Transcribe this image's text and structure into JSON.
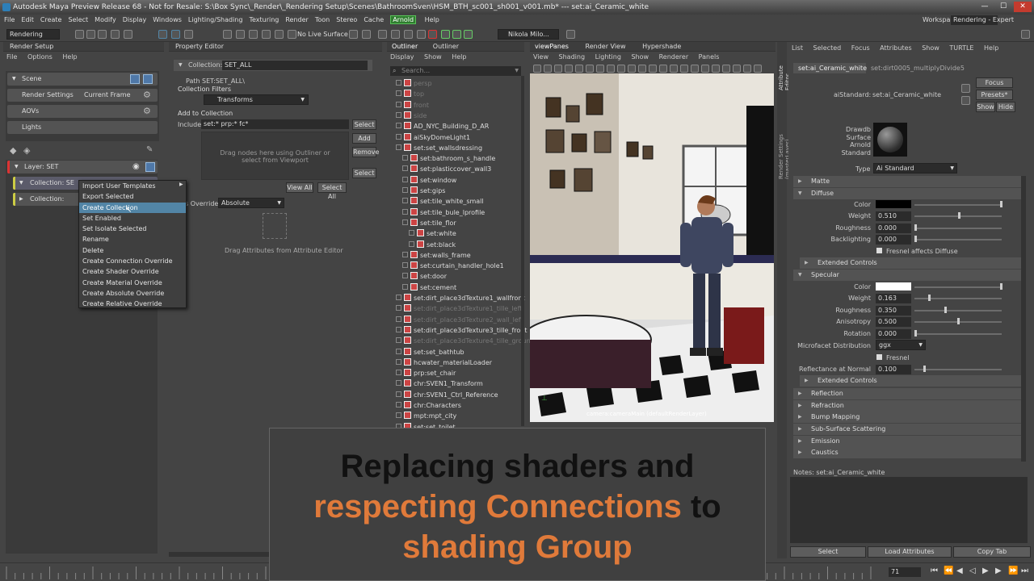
{
  "window": {
    "title": "Autodesk Maya Preview Release 68 - Not for Resale: S:\\Box Sync\\_Render\\_Rendering Setup\\Scenes\\BathroomSven\\HSM_BTH_sc001_sh001_v001.mb*  ---  set:ai_Ceramic_white"
  },
  "menubar": {
    "items": [
      "File",
      "Edit",
      "Create",
      "Select",
      "Modify",
      "Display",
      "Windows",
      "Lighting/Shading",
      "Texturing",
      "Render",
      "Toon",
      "Stereo",
      "Cache"
    ],
    "arnold": "Arnold",
    "help": "Help",
    "workspace_label": "Workspace :",
    "workspace_value": "Rendering - Expert"
  },
  "statusbar": {
    "mode": "Rendering",
    "live_surface": "No Live Surface",
    "user": "Nikola Milo..."
  },
  "render_setup": {
    "title": "Render Setup",
    "menu": [
      "File",
      "Options",
      "Help"
    ],
    "scene": "Scene",
    "render_settings": "Render Settings",
    "current_frame": "Current Frame",
    "aovs": "AOVs",
    "lights": "Lights",
    "layer": "Layer:  SET",
    "collection1": "Collection:  SE",
    "collection2": "Collection:"
  },
  "context_menu": {
    "items": [
      "Import User Templates",
      "Export Selected",
      "Create Collection",
      "Set Enabled",
      "Set Isolate Selected",
      "Rename",
      "Delete",
      "Create Connection Override",
      "Create Shader Override",
      "Create Material Override",
      "Create Absolute Override",
      "Create Relative Override"
    ],
    "selected": "Create Collection"
  },
  "property_editor": {
    "title": "Property Editor",
    "collection_label": "Collection:",
    "collection_value": "SET_ALL",
    "path_label": "Path",
    "path_value": "SET:SET_ALL\\",
    "collection_filters": "Collection Filters",
    "filter_value": "Transforms",
    "add_to_collection": "Add to Collection",
    "include_label": "Include",
    "include_value": "set:* prp:* fc*",
    "select": "Select",
    "add": "Add",
    "remove": "Remove",
    "select2": "Select",
    "drag_hint": "Drag nodes here using Outliner or select from Viewport",
    "view_all": "View All",
    "select_all": "Select All",
    "override_label": "s Override",
    "override_value": "Absolute",
    "drag_attr": "Drag Attributes from Attribute Editor"
  },
  "outliner": {
    "tabs": [
      "Outliner",
      "Outliner"
    ],
    "menu": [
      "Display",
      "Show",
      "Help"
    ],
    "search": "Search...",
    "items": [
      {
        "text": "persp",
        "dim": true,
        "indent": 0
      },
      {
        "text": "top",
        "dim": true,
        "indent": 0
      },
      {
        "text": "front",
        "dim": true,
        "indent": 0
      },
      {
        "text": "side",
        "dim": true,
        "indent": 0
      },
      {
        "text": "AD_NYC_Building_D_AR",
        "dim": false,
        "indent": 0
      },
      {
        "text": "aiSkyDomeLight1",
        "dim": false,
        "indent": 0
      },
      {
        "text": "set:set_wallsdressing",
        "dim": false,
        "indent": 0
      },
      {
        "text": "set:bathroom_s_handle",
        "dim": false,
        "indent": 1
      },
      {
        "text": "set:plasticcover_wall3",
        "dim": false,
        "indent": 1
      },
      {
        "text": "set:window",
        "dim": false,
        "indent": 1
      },
      {
        "text": "set:gips",
        "dim": false,
        "indent": 1
      },
      {
        "text": "set:tile_white_small",
        "dim": false,
        "indent": 1
      },
      {
        "text": "set:tile_bule_lprofile",
        "dim": false,
        "indent": 1
      },
      {
        "text": "set:tile_flor",
        "dim": false,
        "indent": 1
      },
      {
        "text": "set:white",
        "dim": false,
        "indent": 2
      },
      {
        "text": "set:black",
        "dim": false,
        "indent": 2
      },
      {
        "text": "set:walls_frame",
        "dim": false,
        "indent": 1
      },
      {
        "text": "set:curtain_handler_hole1",
        "dim": false,
        "indent": 1
      },
      {
        "text": "set:door",
        "dim": false,
        "indent": 1
      },
      {
        "text": "set:cement",
        "dim": false,
        "indent": 1
      },
      {
        "text": "set:dirt_place3dTexture1_wallfront",
        "dim": false,
        "indent": 0
      },
      {
        "text": "set:dirt_place3dTexture1_tille_left",
        "dim": true,
        "indent": 0
      },
      {
        "text": "set:dirt_place3dTexture2_wall_left",
        "dim": true,
        "indent": 0
      },
      {
        "text": "set:dirt_place3dTexture3_tille_front",
        "dim": false,
        "indent": 0
      },
      {
        "text": "set:dirt_place3dTexture4_tille_ground",
        "dim": true,
        "indent": 0
      },
      {
        "text": "set:set_bathtub",
        "dim": false,
        "indent": 0
      },
      {
        "text": "hcwater_materialLoader",
        "dim": false,
        "indent": 0
      },
      {
        "text": "prp:set_chair",
        "dim": false,
        "indent": 0
      },
      {
        "text": "chr:SVEN1_Transform",
        "dim": false,
        "indent": 0
      },
      {
        "text": "chr:SVEN1_Ctrl_Reference",
        "dim": false,
        "indent": 0
      },
      {
        "text": "chr:Characters",
        "dim": false,
        "indent": 0
      },
      {
        "text": "mpt:mpt_city",
        "dim": false,
        "indent": 0
      },
      {
        "text": "set:set_toilet",
        "dim": false,
        "indent": 0
      }
    ]
  },
  "viewport": {
    "tabs": [
      "viewPanes",
      "Render View",
      "Hypershade"
    ],
    "menu": [
      "View",
      "Shading",
      "Lighting",
      "Show",
      "Renderer",
      "Panels"
    ],
    "camera_label": "camera:cameraMain (defaultRenderLayer)"
  },
  "attribute_editor": {
    "menu": [
      "List",
      "Selected",
      "Focus",
      "Attributes",
      "Show",
      "TURTLE",
      "Help"
    ],
    "tab1": "set:ai_Ceramic_white",
    "tab2": "set:dirt0005_multiplyDivide5",
    "node_label": "aiStandard:",
    "node_value": "set:ai_Ceramic_white",
    "focus": "Focus",
    "presets": "Presets*",
    "show": "Show",
    "hide": "Hide",
    "swatch_desc": [
      "Drawdb",
      "Surface",
      "Arnold",
      "Standard"
    ],
    "type_label": "Type",
    "type_value": "Ai Standard",
    "side_label1": "Attribute Editor",
    "side_label2": "Render Settings (masterLayer)",
    "matte": "Matte",
    "diffuse": "Diffuse",
    "color": "Color",
    "weight": "Weight",
    "weight_val": "0.510",
    "weight_frac": 0.51,
    "roughness": "Roughness",
    "roughness_val": "0.000",
    "backlighting": "Backlighting",
    "backlighting_val": "0.000",
    "fresnel_diffuse": "Fresnel affects Diffuse",
    "extended_controls": "Extended Controls",
    "specular": "Specular",
    "spec_color": "Color",
    "spec_weight": "Weight",
    "spec_weight_val": "0.163",
    "spec_weight_frac": 0.163,
    "spec_roughness": "Roughness",
    "spec_roughness_val": "0.350",
    "spec_roughness_frac": 0.35,
    "anisotropy": "Anisotropy",
    "anisotropy_val": "0.500",
    "anisotropy_frac": 0.5,
    "rotation": "Rotation",
    "rotation_val": "0.000",
    "microfacet": "Microfacet Distribution",
    "microfacet_val": "ggx",
    "fresnel": "Fresnel",
    "refl_normal": "Reflectance at Normal",
    "refl_normal_val": "0.100",
    "refl_normal_frac": 0.1,
    "extended_controls2": "Extended Controls",
    "sections": [
      "Reflection",
      "Refraction",
      "Bump Mapping",
      "Sub-Surface Scattering",
      "Emission",
      "Caustics"
    ],
    "notes": "Notes:  set:ai_Ceramic_white",
    "btn_select": "Select",
    "btn_load": "Load Attributes",
    "btn_copy": "Copy Tab"
  },
  "caption": {
    "line1": "Replacing shaders and",
    "line2a": "respecting Connections",
    "line2b": " to",
    "line3": "shading Group"
  },
  "timeline": {
    "frame": "71"
  },
  "colors": {
    "accent": "#5285a6",
    "arnold_green": "#2f7d2f",
    "caption_orange": "#e07a3a"
  }
}
